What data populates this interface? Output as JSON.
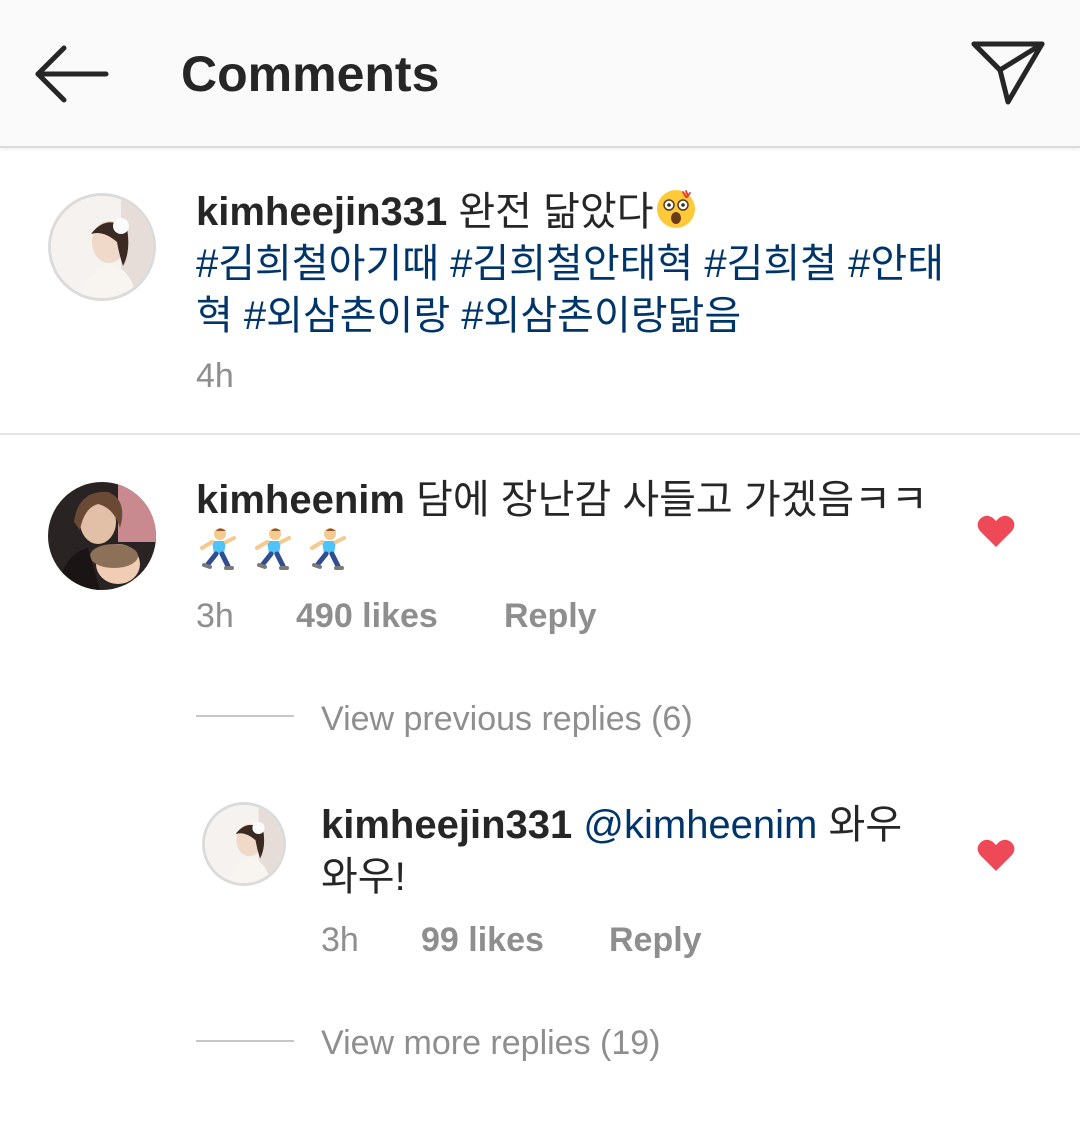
{
  "header": {
    "title": "Comments",
    "back_icon": "arrow-left-icon",
    "share_icon": "paper-plane-icon"
  },
  "caption": {
    "username": "kimheejin331",
    "text": "완전 닮았다",
    "emoji": "astonished-face-emoji",
    "hashtags": [
      "#김희철아기때",
      "#김희철안태혁",
      "#김희철",
      "#안태",
      "혁 #외삼촌이랑",
      "#외삼촌이랑닮음"
    ],
    "time": "4h"
  },
  "comment": {
    "username": "kimheenim",
    "text": "담에 장난감 사들고 가겠음ㅋㅋ",
    "emojis": [
      "runner-emoji",
      "runner-emoji",
      "runner-emoji"
    ],
    "time": "3h",
    "likes": "490 likes",
    "reply_label": "Reply",
    "liked": true
  },
  "previous_replies": "View previous replies (6)",
  "reply": {
    "username": "kimheejin331",
    "mention": "@kimheenim",
    "text_line1": "와우",
    "text_line2": "와우!",
    "time": "3h",
    "likes": "99 likes",
    "reply_label": "Reply",
    "liked": true
  },
  "more_replies": "View more replies (19)",
  "colors": {
    "heart": "#ed4956",
    "link": "#003569",
    "meta": "#8e8e8e",
    "text": "#262626"
  }
}
